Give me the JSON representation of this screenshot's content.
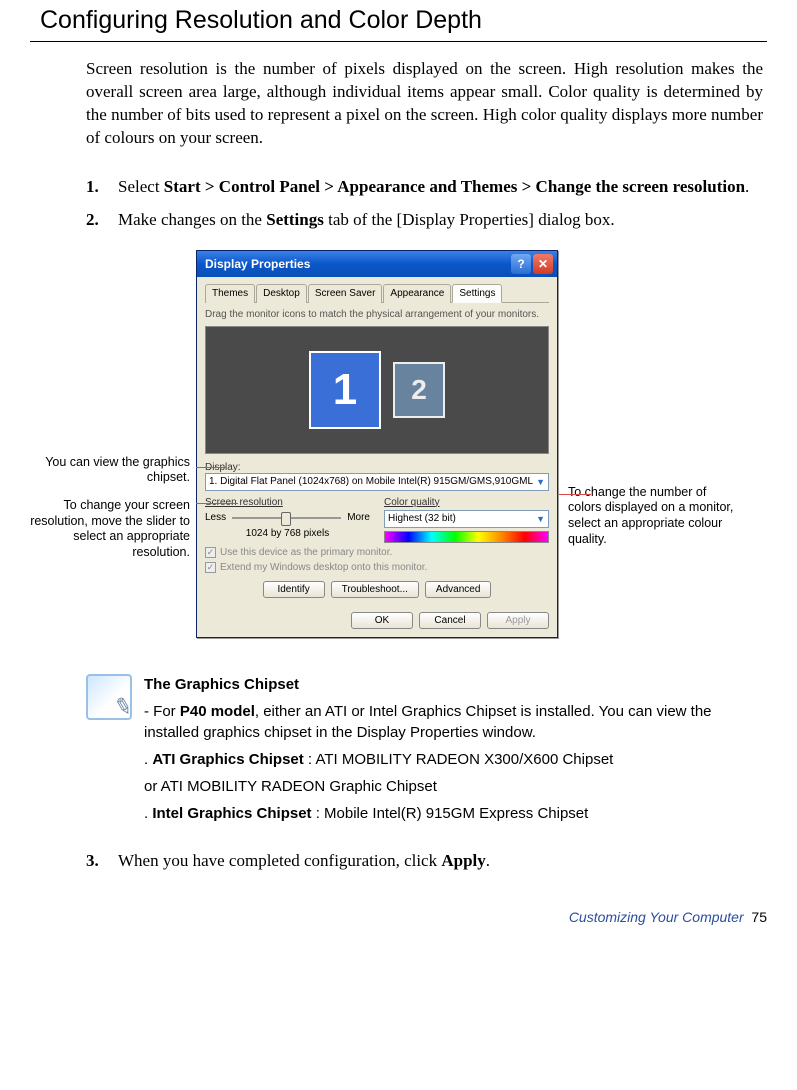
{
  "section_title": "Configuring Resolution and Color Depth",
  "intro": "Screen resolution is the number of pixels displayed on the screen. High resolution makes the overall screen area large, although individual items appear small. Color quality is determined by the number of bits used to represent a pixel on the screen. High color quality displays more number of colours on your screen.",
  "steps": {
    "s1_pre": "Select ",
    "s1_bold": "Start > Control Panel > Appearance and Themes > Change the screen resolution",
    "s1_post": ".",
    "s2_pre": "Make changes on the ",
    "s2_bold": "Settings",
    "s2_post": " tab of the [Display Properties] dialog box.",
    "s3_pre": "When you have completed configuration, click ",
    "s3_bold": "Apply",
    "s3_post": "."
  },
  "callouts": {
    "left1": "You can view the graphics chipset.",
    "left2": "To change your screen resolution, move the slider to select an appropriate resolution.",
    "right1": "To change the number of colors displayed on a monitor, select an appropriate colour quality."
  },
  "dialog": {
    "title": "Display Properties",
    "help": "?",
    "close": "✕",
    "tabs": [
      "Themes",
      "Desktop",
      "Screen Saver",
      "Appearance",
      "Settings"
    ],
    "active_tab": 4,
    "hint": "Drag the monitor icons to match the physical arrangement of your monitors.",
    "mon1": "1",
    "mon2": "2",
    "display_label": "Display:",
    "display_value": "1. Digital Flat Panel (1024x768) on Mobile Intel(R) 915GM/GMS,910GML",
    "res_label": "Screen resolution",
    "res_less": "Less",
    "res_more": "More",
    "res_value": "1024 by 768 pixels",
    "color_label": "Color quality",
    "color_value": "Highest (32 bit)",
    "chk1": "Use this device as the primary monitor.",
    "chk2": "Extend my Windows desktop onto this monitor.",
    "btn_identify": "Identify",
    "btn_troubleshoot": "Troubleshoot...",
    "btn_advanced": "Advanced",
    "btn_ok": "OK",
    "btn_cancel": "Cancel",
    "btn_apply": "Apply"
  },
  "note": {
    "title": "The Graphics Chipset",
    "l1_pre": "- For ",
    "l1_bold": "P40 model",
    "l1_post": ", either an ATI or Intel Graphics Chipset is installed. You can view the installed graphics chipset in the Display Properties window.",
    "l2_pre": ". ",
    "l2_bold": "ATI Graphics Chipset",
    "l2_post": " : ATI MOBILITY RADEON X300/X600 Chipset",
    "l3": "or ATI MOBILITY RADEON Graphic Chipset",
    "l4_pre": ". ",
    "l4_bold": "Intel Graphics Chipset",
    "l4_post": " : Mobile Intel(R) 915GM Express Chipset"
  },
  "footer": {
    "section": "Customizing Your Computer",
    "page": "75"
  }
}
